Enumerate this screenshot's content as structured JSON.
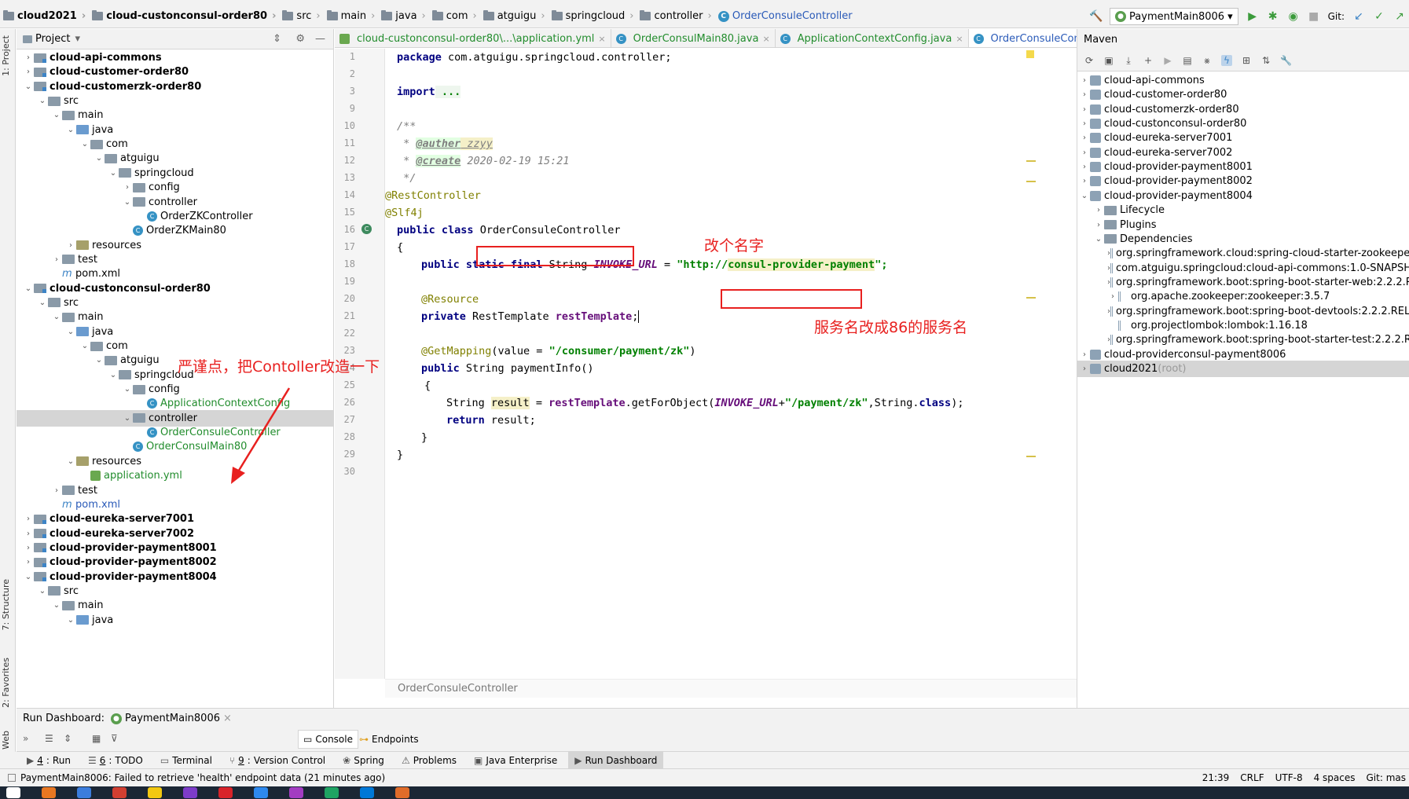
{
  "navbar": {
    "crumbs": [
      "cloud2021",
      "cloud-custonconsul-order80",
      "src",
      "main",
      "java",
      "com",
      "atguigu",
      "springcloud",
      "controller",
      "OrderConsuleController"
    ],
    "run_config": "PaymentMain8006",
    "git_label": "Git:"
  },
  "editor_tabs": [
    {
      "label": "cloud-custonconsul-order80\\...\\application.yml",
      "active": false
    },
    {
      "label": "OrderConsulMain80.java",
      "active": false
    },
    {
      "label": "ApplicationContextConfig.java",
      "active": false
    },
    {
      "label": "OrderConsuleController.java",
      "active": true
    }
  ],
  "editor_tabs_extra": "6",
  "project_panel": {
    "title": "Project",
    "tree": [
      {
        "label": "cloud-api-commons",
        "depth": 0,
        "arrow": "›",
        "kind": "module",
        "bold": true
      },
      {
        "label": "cloud-customer-order80",
        "depth": 0,
        "arrow": "›",
        "kind": "module",
        "bold": true
      },
      {
        "label": "cloud-customerzk-order80",
        "depth": 0,
        "arrow": "⌄",
        "kind": "module",
        "bold": true
      },
      {
        "label": "src",
        "depth": 1,
        "arrow": "⌄",
        "kind": "folder"
      },
      {
        "label": "main",
        "depth": 2,
        "arrow": "⌄",
        "kind": "folder"
      },
      {
        "label": "java",
        "depth": 3,
        "arrow": "⌄",
        "kind": "srcfolder"
      },
      {
        "label": "com",
        "depth": 4,
        "arrow": "⌄",
        "kind": "folder"
      },
      {
        "label": "atguigu",
        "depth": 5,
        "arrow": "⌄",
        "kind": "folder"
      },
      {
        "label": "springcloud",
        "depth": 6,
        "arrow": "⌄",
        "kind": "folder"
      },
      {
        "label": "config",
        "depth": 7,
        "arrow": "›",
        "kind": "folder"
      },
      {
        "label": "controller",
        "depth": 7,
        "arrow": "⌄",
        "kind": "folder"
      },
      {
        "label": "OrderZKController",
        "depth": 8,
        "arrow": "",
        "kind": "class"
      },
      {
        "label": "OrderZKMain80",
        "depth": 7,
        "arrow": "",
        "kind": "class"
      },
      {
        "label": "resources",
        "depth": 3,
        "arrow": "›",
        "kind": "resfolder"
      },
      {
        "label": "test",
        "depth": 2,
        "arrow": "›",
        "kind": "folder"
      },
      {
        "label": "pom.xml",
        "depth": 2,
        "arrow": "",
        "kind": "xml"
      },
      {
        "label": "cloud-custonconsul-order80",
        "depth": 0,
        "arrow": "⌄",
        "kind": "module",
        "bold": true
      },
      {
        "label": "src",
        "depth": 1,
        "arrow": "⌄",
        "kind": "folder"
      },
      {
        "label": "main",
        "depth": 2,
        "arrow": "⌄",
        "kind": "folder"
      },
      {
        "label": "java",
        "depth": 3,
        "arrow": "⌄",
        "kind": "srcfolder"
      },
      {
        "label": "com",
        "depth": 4,
        "arrow": "⌄",
        "kind": "folder"
      },
      {
        "label": "atguigu",
        "depth": 5,
        "arrow": "⌄",
        "kind": "folder"
      },
      {
        "label": "springcloud",
        "depth": 6,
        "arrow": "⌄",
        "kind": "folder"
      },
      {
        "label": "config",
        "depth": 7,
        "arrow": "⌄",
        "kind": "folder"
      },
      {
        "label": "ApplicationContextConfig",
        "depth": 8,
        "arrow": "",
        "kind": "class",
        "color": "green"
      },
      {
        "label": "controller",
        "depth": 7,
        "arrow": "⌄",
        "kind": "folder",
        "selected": true
      },
      {
        "label": "OrderConsuleController",
        "depth": 8,
        "arrow": "",
        "kind": "class",
        "color": "green"
      },
      {
        "label": "OrderConsulMain80",
        "depth": 7,
        "arrow": "",
        "kind": "class",
        "color": "green"
      },
      {
        "label": "resources",
        "depth": 3,
        "arrow": "⌄",
        "kind": "resfolder"
      },
      {
        "label": "application.yml",
        "depth": 4,
        "arrow": "",
        "kind": "yml",
        "color": "green"
      },
      {
        "label": "test",
        "depth": 2,
        "arrow": "›",
        "kind": "folder"
      },
      {
        "label": "pom.xml",
        "depth": 2,
        "arrow": "",
        "kind": "xml",
        "color": "blue"
      },
      {
        "label": "cloud-eureka-server7001",
        "depth": 0,
        "arrow": "›",
        "kind": "module",
        "bold": true
      },
      {
        "label": "cloud-eureka-server7002",
        "depth": 0,
        "arrow": "›",
        "kind": "module",
        "bold": true
      },
      {
        "label": "cloud-provider-payment8001",
        "depth": 0,
        "arrow": "›",
        "kind": "module",
        "bold": true
      },
      {
        "label": "cloud-provider-payment8002",
        "depth": 0,
        "arrow": "›",
        "kind": "module",
        "bold": true
      },
      {
        "label": "cloud-provider-payment8004",
        "depth": 0,
        "arrow": "⌄",
        "kind": "module",
        "bold": true
      },
      {
        "label": "src",
        "depth": 1,
        "arrow": "⌄",
        "kind": "folder"
      },
      {
        "label": "main",
        "depth": 2,
        "arrow": "⌄",
        "kind": "folder"
      },
      {
        "label": "java",
        "depth": 3,
        "arrow": "⌄",
        "kind": "srcfolder"
      }
    ]
  },
  "left_strip": {
    "project": "1: Project",
    "structure": "7: Structure",
    "favorites": "2: Favorites",
    "web": "Web"
  },
  "code": {
    "line_numbers": [
      "1",
      "2",
      "3",
      "9",
      "10",
      "11",
      "12",
      "13",
      "14",
      "15",
      "16",
      "17",
      "18",
      "19",
      "20",
      "21",
      "22",
      "23",
      "24",
      "25",
      "26",
      "27",
      "28",
      "29",
      "30"
    ],
    "package_kw": "package",
    "package_name": " com.atguigu.springcloud.controller;",
    "import_kw": "import",
    "import_dots": " ...",
    "jd_open": "/**",
    "jd_star": " * ",
    "auther_tag": "@auther",
    "auther_val": " zzyy",
    "create_tag": "@create",
    "create_val": " 2020-02-19 15:21",
    "jd_close": " */",
    "ann_rest": "@RestController",
    "ann_slf": "@Slf4j",
    "public": "public",
    "class_kw": "class",
    "class_name": "OrderConsuleController",
    "brace_open": "{",
    "static": "static",
    "final": "final",
    "string_type": "String",
    "invoke_url": "INVOKE_URL",
    "eq": " = ",
    "url_prefix": "\"http://",
    "url_service": "consul-provider-payment",
    "url_end": "\";",
    "resource_ann": "@Resource",
    "private": "private",
    "rest_template_type": "RestTemplate",
    "rest_template": "restTemplate",
    "getmapping": "@GetMapping",
    "value_attr": "(value = ",
    "mapping_path": "\"/consumer/payment/zk\"",
    "mapping_close": ")",
    "method_sig": "String paymentInfo()",
    "brace2": "{",
    "result_type": "String ",
    "result_var": "result",
    "assign": " = ",
    "getfor": ".getForObject(",
    "plus": "+",
    "path_lit": "\"/payment/zk\"",
    "tail": ",String.",
    "class_word": "class",
    "end_paren": ");",
    "return_kw": "return",
    "return_val": " result;",
    "close_inner": "}",
    "close_outer": "}",
    "semicolon": ";"
  },
  "annotations": {
    "rename_note": "改个名字",
    "service_note": "服务名改成86的服务名",
    "controller_note": "严谨点，把Contoller改造一下"
  },
  "editor_breadcrumb": "OrderConsuleController",
  "maven": {
    "title": "Maven",
    "items": [
      {
        "label": "cloud-api-commons",
        "depth": 0,
        "arrow": "›"
      },
      {
        "label": "cloud-customer-order80",
        "depth": 0,
        "arrow": "›"
      },
      {
        "label": "cloud-customerzk-order80",
        "depth": 0,
        "arrow": "›"
      },
      {
        "label": "cloud-custonconsul-order80",
        "depth": 0,
        "arrow": "›"
      },
      {
        "label": "cloud-eureka-server7001",
        "depth": 0,
        "arrow": "›"
      },
      {
        "label": "cloud-eureka-server7002",
        "depth": 0,
        "arrow": "›"
      },
      {
        "label": "cloud-provider-payment8001",
        "depth": 0,
        "arrow": "›"
      },
      {
        "label": "cloud-provider-payment8002",
        "depth": 0,
        "arrow": "›"
      },
      {
        "label": "cloud-provider-payment8004",
        "depth": 0,
        "arrow": "⌄"
      },
      {
        "label": "Lifecycle",
        "depth": 1,
        "arrow": "›",
        "kind": "folder"
      },
      {
        "label": "Plugins",
        "depth": 1,
        "arrow": "›",
        "kind": "folder"
      },
      {
        "label": "Dependencies",
        "depth": 1,
        "arrow": "⌄",
        "kind": "folder"
      },
      {
        "label": "org.springframework.cloud:spring-cloud-starter-zookeeper-discovery",
        "depth": 2,
        "arrow": "›",
        "kind": "dep"
      },
      {
        "label": "com.atguigu.springcloud:cloud-api-commons:1.0-SNAPSHOT",
        "depth": 2,
        "arrow": "›",
        "kind": "dep"
      },
      {
        "label": "org.springframework.boot:spring-boot-starter-web:2.2.2.RELEASE",
        "depth": 2,
        "arrow": "›",
        "kind": "dep"
      },
      {
        "label": "org.apache.zookeeper:zookeeper:3.5.7",
        "depth": 2,
        "arrow": "›",
        "kind": "dep"
      },
      {
        "label": "org.springframework.boot:spring-boot-devtools:2.2.2.RELEASE",
        "depth": 2,
        "arrow": "›",
        "kind": "dep"
      },
      {
        "label": "org.projectlombok:lombok:1.16.18",
        "depth": 2,
        "arrow": "",
        "kind": "dep"
      },
      {
        "label": "org.springframework.boot:spring-boot-starter-test:2.2.2.RELEASE",
        "depth": 2,
        "arrow": "›",
        "kind": "dep"
      },
      {
        "label": "cloud-providerconsul-payment8006",
        "depth": 0,
        "arrow": "›"
      },
      {
        "label": "cloud2021",
        "depth": 0,
        "arrow": "›",
        "suffix": " (root)",
        "selected": true
      }
    ]
  },
  "run_dashboard": {
    "label": "Run Dashboard:",
    "tab": "PaymentMain8006",
    "console": "Console",
    "endpoints": "Endpoints"
  },
  "bottom_tabs": [
    {
      "num": "4",
      "label": "Run"
    },
    {
      "num": "6",
      "label": "TODO"
    },
    {
      "num": "",
      "label": "Terminal"
    },
    {
      "num": "9",
      "label": "Version Control"
    },
    {
      "num": "",
      "label": "Spring"
    },
    {
      "num": "",
      "label": "Problems"
    },
    {
      "num": "",
      "label": "Java Enterprise"
    },
    {
      "num": "",
      "label": "Run Dashboard",
      "active": true
    }
  ],
  "status": {
    "message": "PaymentMain8006: Failed to retrieve 'health' endpoint data (21 minutes ago)",
    "position": "21:39",
    "line_sep": "CRLF",
    "encoding": "UTF-8",
    "indent": "4 spaces",
    "git": "Git: mas"
  },
  "colors": {
    "annotation_red": "#e8201f",
    "keyword": "#000080",
    "string": "#008000",
    "field": "#660e7a"
  }
}
